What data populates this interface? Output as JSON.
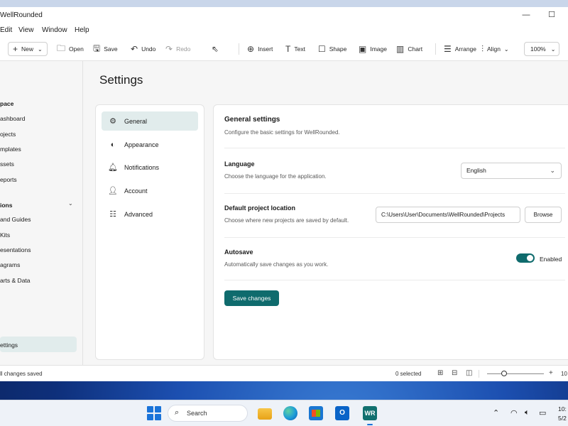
{
  "window": {
    "title": "WellRounded",
    "minimize_glyph": "—",
    "maximize_glyph": "☐"
  },
  "menu": [
    "Edit",
    "View",
    "Window",
    "Help"
  ],
  "toolbar": {
    "new": "New",
    "open": "Open",
    "save": "Save",
    "undo": "Undo",
    "redo": "Redo",
    "insert": "Insert",
    "text": "Text",
    "shape": "Shape",
    "image": "Image",
    "chart": "Chart",
    "arrange": "Arrange",
    "align": "Align",
    "zoom": "100%"
  },
  "sidebar": {
    "section1": "pace",
    "items1": [
      "ashboard",
      "ojects",
      "mplates",
      "ssets",
      "eports"
    ],
    "section2": "ions",
    "items2": [
      "and Guides",
      "Kits",
      "esentations",
      "agrams",
      "arts & Data"
    ],
    "active": "ettings"
  },
  "main": {
    "page_title": "Settings",
    "nav": [
      {
        "label": "General",
        "icon": "gear-icon"
      },
      {
        "label": "Appearance",
        "icon": "palette-icon"
      },
      {
        "label": "Notifications",
        "icon": "bell-icon"
      },
      {
        "label": "Account",
        "icon": "person-icon"
      },
      {
        "label": "Advanced",
        "icon": "sliders-icon"
      }
    ],
    "general": {
      "title": "General settings",
      "subtitle": "Configure the basic settings for WellRounded."
    },
    "language": {
      "label": "Language",
      "desc": "Choose the language for the application.",
      "value": "English"
    },
    "location": {
      "label": "Default project location",
      "desc": "Choose where new projects are saved by default.",
      "value": "C:\\Users\\User\\Documents\\WellRounded\\Projects",
      "browse": "Browse"
    },
    "autosave": {
      "label": "Autosave",
      "desc": "Automatically save changes as you work.",
      "state": "Enabled",
      "on": true
    },
    "save_button": "Save changes"
  },
  "status": {
    "left": "ll changes saved",
    "selected": "0 selected",
    "zoom": "10"
  },
  "taskbar": {
    "search": "Search",
    "wr_label": "WR",
    "outlook_label": "O",
    "time": "10:",
    "date": "5/2"
  },
  "colors": {
    "accent": "#0f6b6d",
    "active_bg": "#e1ecec"
  }
}
